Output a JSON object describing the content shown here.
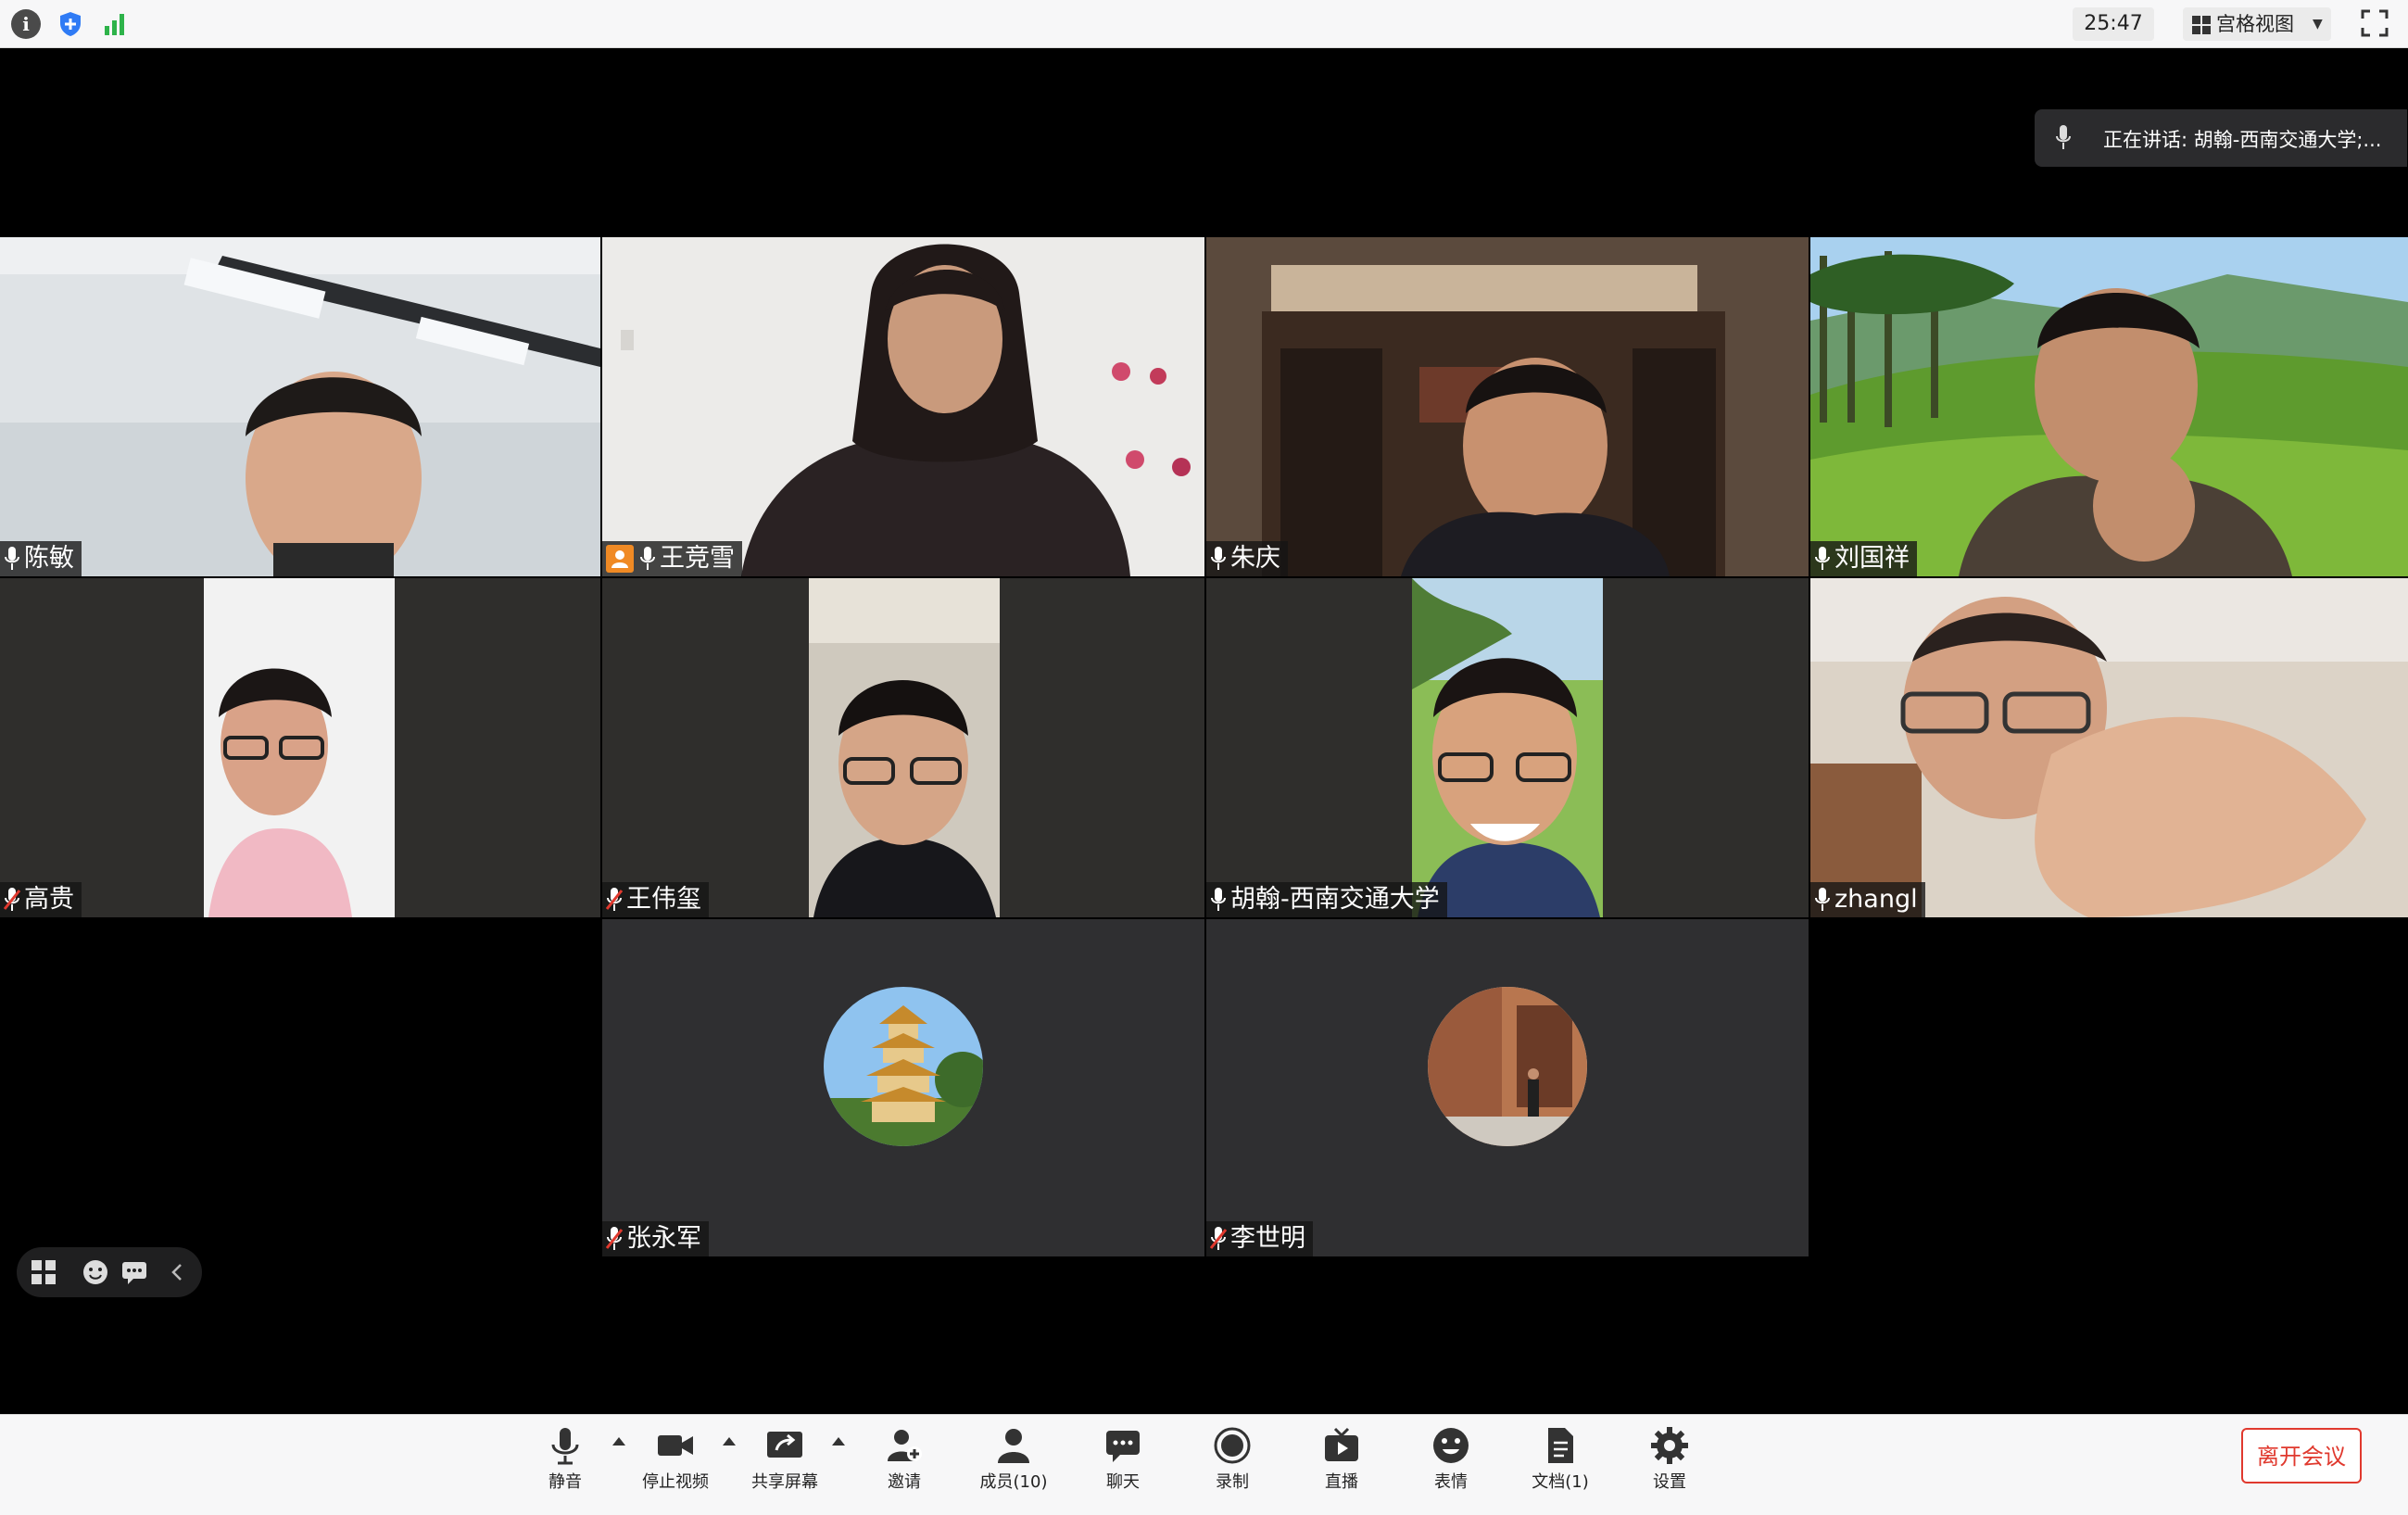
{
  "topbar": {
    "info_icon": "info-icon",
    "shield_icon": "security-shield-icon",
    "signal_icon": "network-signal-icon",
    "timer": "25:47",
    "view_mode_label": "宫格视图",
    "fullscreen_icon": "fullscreen-icon"
  },
  "speaking": {
    "text": "正在讲话: 胡翰-西南交通大学;..."
  },
  "participants": [
    {
      "name": "陈敏",
      "muted": false,
      "host": false
    },
    {
      "name": "王竞雪",
      "muted": false,
      "host": true
    },
    {
      "name": "朱庆",
      "muted": false,
      "host": false
    },
    {
      "name": "刘国祥",
      "muted": false,
      "host": false
    },
    {
      "name": "高贵",
      "muted": true,
      "host": false
    },
    {
      "name": "王伟玺",
      "muted": true,
      "host": false
    },
    {
      "name": "胡翰-西南交通大学",
      "muted": false,
      "host": false,
      "speaking": true
    },
    {
      "name": "zhangl",
      "muted": false,
      "host": false
    },
    {
      "name": "张永军",
      "muted": true,
      "host": false
    },
    {
      "name": "李世明",
      "muted": true,
      "host": false
    }
  ],
  "float_bar": {
    "icons": [
      "layout-icon",
      "emoji-icon",
      "chat-icon",
      "collapse-icon"
    ]
  },
  "toolbar": {
    "mute": "静音",
    "stop_video": "停止视频",
    "share_screen": "共享屏幕",
    "invite": "邀请",
    "members": "成员(10)",
    "chat": "聊天",
    "record": "录制",
    "live": "直播",
    "reaction": "表情",
    "docs": "文档(1)",
    "settings": "设置",
    "leave": "离开会议"
  },
  "colors": {
    "leave_red": "#e0392e",
    "speaking_green": "#2c8a2f",
    "host_orange": "#f08a24",
    "mute_red": "#e0392e"
  }
}
